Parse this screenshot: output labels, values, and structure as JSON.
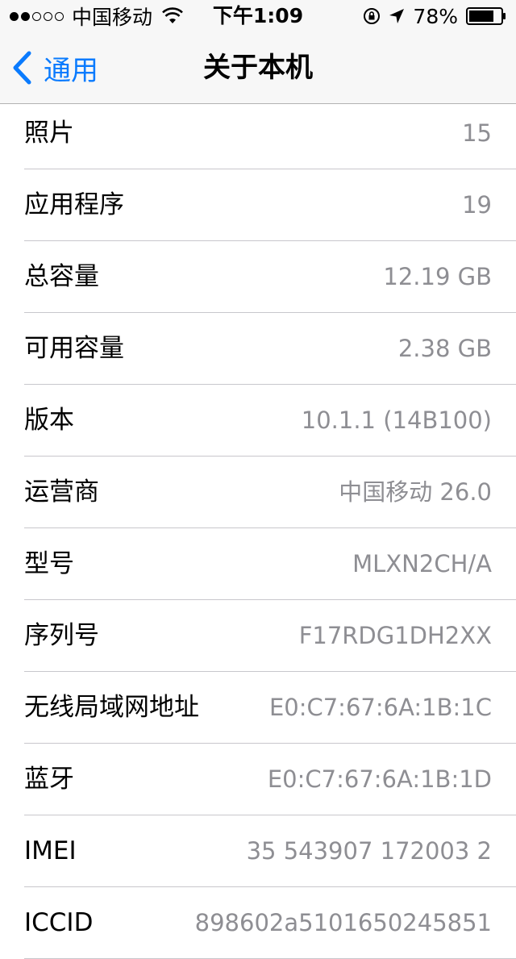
{
  "status_bar": {
    "carrier": "中国移动",
    "time": "下午1:09",
    "battery": "78%"
  },
  "nav": {
    "back_label": "通用",
    "title": "关于本机"
  },
  "rows": [
    {
      "label": "照片",
      "value": "15"
    },
    {
      "label": "应用程序",
      "value": "19"
    },
    {
      "label": "总容量",
      "value": "12.19 GB"
    },
    {
      "label": "可用容量",
      "value": "2.38 GB"
    },
    {
      "label": "版本",
      "value": "10.1.1 (14B100)"
    },
    {
      "label": "运营商",
      "value": "中国移动 26.0"
    },
    {
      "label": "型号",
      "value": "MLXN2CH/A"
    },
    {
      "label": "序列号",
      "value": "F17RDG1DH2XX"
    },
    {
      "label": "无线局域网地址",
      "value": "E0:C7:67:6A:1B:1C"
    },
    {
      "label": "蓝牙",
      "value": "E0:C7:67:6A:1B:1D"
    },
    {
      "label": "IMEI",
      "value": "35 543907 172003 2"
    },
    {
      "label": "ICCID",
      "value": "898602a5101650245851"
    }
  ],
  "colors": {
    "accent": "#0a7bfe",
    "value_text": "#8e8e93",
    "separator": "#c8c7cc",
    "bar_background": "#f7f7f7"
  },
  "icons": [
    "signal-dots-icon",
    "wifi-icon",
    "rotation-lock-icon",
    "location-arrow-icon",
    "battery-icon",
    "back-chevron-icon"
  ]
}
